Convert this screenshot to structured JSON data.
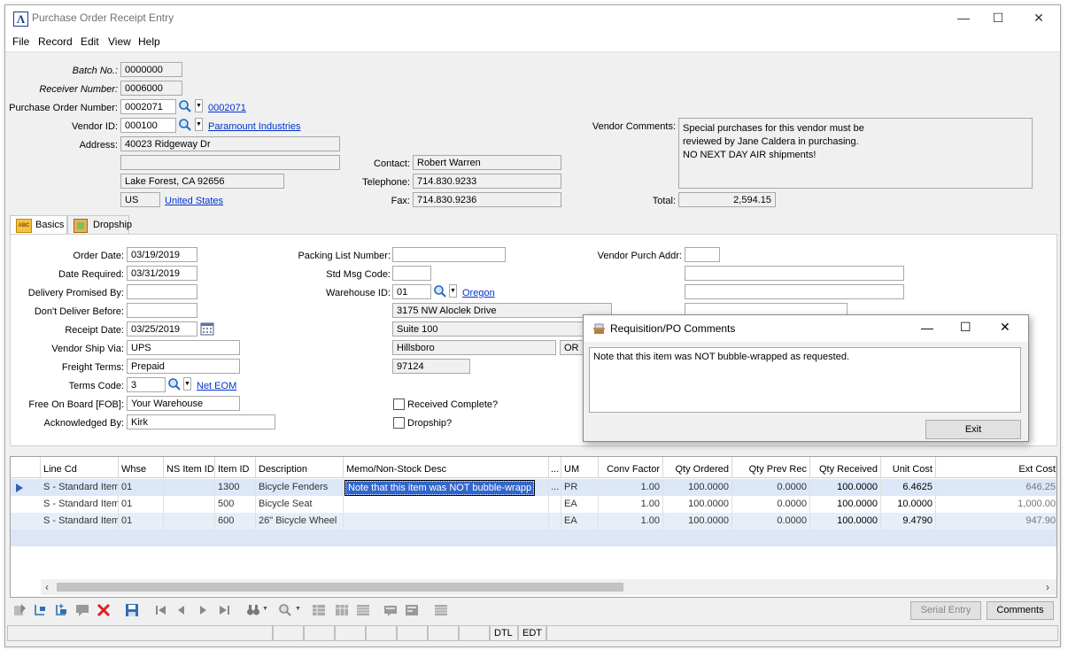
{
  "window": {
    "title": "Purchase Order Receipt Entry",
    "minimize": "—",
    "maximize": "☐",
    "close": "✕"
  },
  "menu": [
    "File",
    "Record",
    "Edit",
    "View",
    "Help"
  ],
  "header": {
    "batch_no_label": "Batch No.:",
    "batch_no": "0000000",
    "receiver_label": "Receiver Number:",
    "receiver": "0006000",
    "po_label": "Purchase Order Number:",
    "po": "0002071",
    "po_link": "0002071",
    "vendor_label": "Vendor ID:",
    "vendor": "000100",
    "vendor_link": "Paramount Industries",
    "address_label": "Address:",
    "address1": "40023 Ridgeway Dr",
    "address2": "",
    "address3": "Lake Forest, CA  92656",
    "country_code": "US",
    "country_link": "United States",
    "contact_label": "Contact:",
    "contact": "Robert Warren",
    "telephone_label": "Telephone:",
    "telephone": "714.830.9233",
    "fax_label": "Fax:",
    "fax": "714.830.9236",
    "vendor_comments_label": "Vendor Comments:",
    "vendor_comments": [
      "Special purchases for this vendor must be",
      "reviewed by Jane Caldera in purchasing.",
      "NO NEXT DAY AIR shipments!"
    ],
    "total_label": "Total:",
    "total": "2,594.15"
  },
  "tabs": [
    {
      "label": "Basics",
      "icon": "abc-icon"
    },
    {
      "label": "Dropship",
      "icon": "box-icon"
    }
  ],
  "basics": {
    "order_date_label": "Order Date:",
    "order_date": "03/19/2019",
    "date_required_label": "Date Required:",
    "date_required": "03/31/2019",
    "delivery_promised_label": "Delivery Promised By:",
    "delivery_promised": "",
    "dont_deliver_label": "Don't Deliver Before:",
    "dont_deliver": "",
    "receipt_date_label": "Receipt Date:",
    "receipt_date": "03/25/2019",
    "ship_via_label": "Vendor Ship Via:",
    "ship_via": "UPS",
    "freight_label": "Freight Terms:",
    "freight": "Prepaid",
    "terms_label": "Terms Code:",
    "terms": "3",
    "terms_link": "Net EOM",
    "fob_label": "Free On Board [FOB]:",
    "fob": "Your Warehouse",
    "ack_label": "Acknowledged By:",
    "ack": "Kirk",
    "packing_label": "Packing List Number:",
    "packing": "",
    "std_msg_label": "Std Msg Code:",
    "std_msg": "",
    "warehouse_label": "Warehouse ID:",
    "warehouse": "01",
    "warehouse_link": "Oregon",
    "wh_address1": "3175 NW Aloclek Drive",
    "wh_address2": "Suite 100",
    "wh_city": "Hillsboro",
    "wh_state": "OR",
    "wh_zip": "97124",
    "received_complete_label": "Received Complete?",
    "dropship_label": "Dropship?",
    "vendor_purch_addr_label": "Vendor Purch Addr:"
  },
  "grid": {
    "columns": [
      "Line Cd",
      "Whse",
      "NS Item ID",
      "Item ID",
      "Description",
      "Memo/Non-Stock Desc",
      "...",
      "UM",
      "Conv Factor",
      "Qty Ordered",
      "Qty Prev Rec",
      "Qty Received",
      "Unit Cost",
      "Ext Cost"
    ],
    "rows": [
      [
        "S - Standard Item",
        "01",
        "",
        "1300",
        "Bicycle Fenders",
        "Note that this item was NOT bubble-wrapp",
        "...",
        "PR",
        "1.00",
        "100.0000",
        "0.0000",
        "100.0000",
        "6.4625",
        "646.25"
      ],
      [
        "S - Standard Item",
        "01",
        "",
        "500",
        "Bicycle Seat",
        "",
        "",
        "EA",
        "1.00",
        "100.0000",
        "0.0000",
        "100.0000",
        "10.0000",
        "1,000.00"
      ],
      [
        "S - Standard Item",
        "01",
        "",
        "600",
        "26\" Bicycle Wheel",
        "",
        "",
        "EA",
        "1.00",
        "100.0000",
        "0.0000",
        "100.0000",
        "9.4790",
        "947.90"
      ]
    ]
  },
  "buttons": {
    "serial_entry": "Serial Entry",
    "comments": "Comments"
  },
  "status": {
    "dtl": "DTL",
    "edt": "EDT"
  },
  "dialog": {
    "title": "Requisition/PO Comments",
    "comment": "Note that this item was NOT bubble-wrapped as requested.",
    "exit": "Exit"
  },
  "colors": {
    "link": "#0033cc",
    "selected_row": "#dce8f8",
    "alt_row": "#e8eef8",
    "selection": "#3366cc"
  }
}
